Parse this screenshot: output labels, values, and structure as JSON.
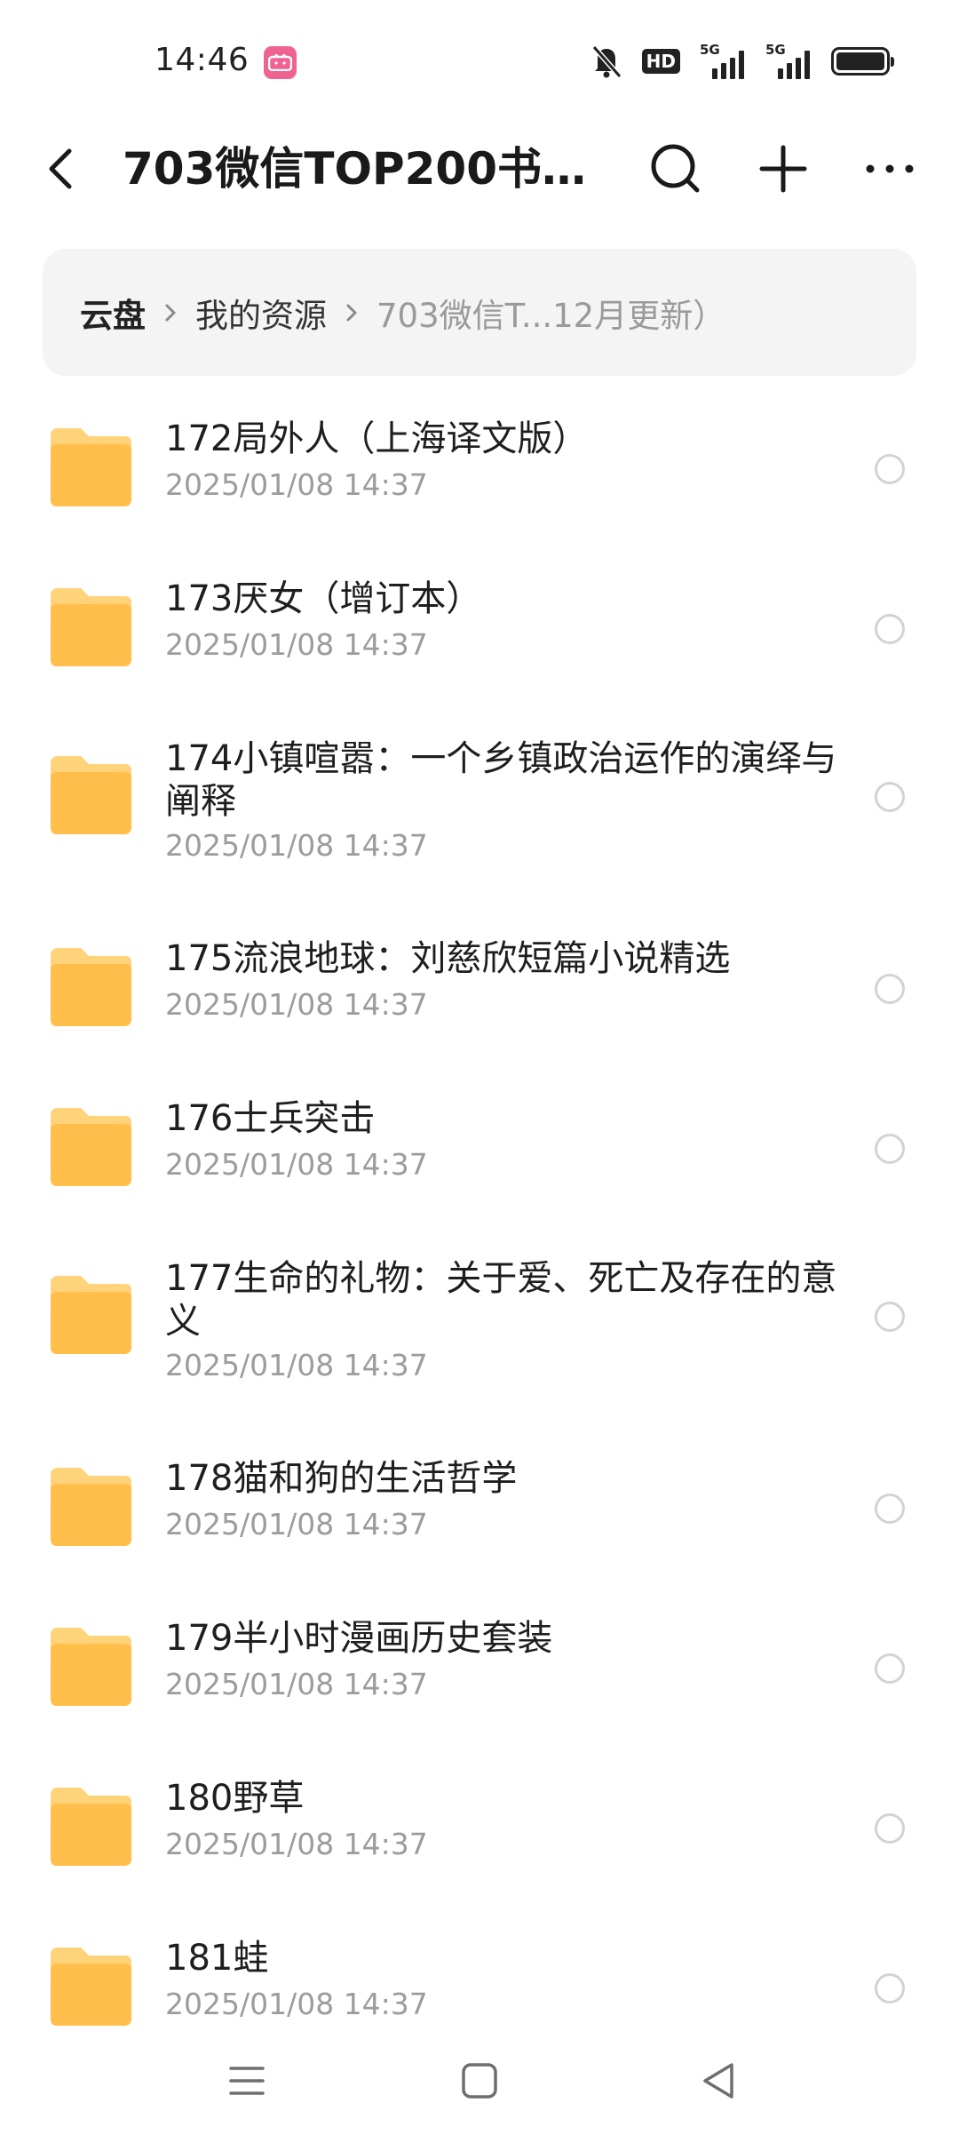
{
  "status_bar": {
    "time": "14:46",
    "app_badge_icon": "bilibili-icon",
    "icons": [
      "mute-icon",
      "hd-voice-icon",
      "signal-5g-icon",
      "signal-5g-icon",
      "battery-icon"
    ],
    "hd_label": "HD",
    "network_label": "5G",
    "network_label_2": "5G"
  },
  "header": {
    "title": "703微信TOP200书…",
    "back_icon": "back-arrow-icon",
    "actions": [
      "search-icon",
      "add-icon",
      "more-icon"
    ]
  },
  "breadcrumb": {
    "items": [
      "云盘",
      "我的资源",
      "703微信T...12月更新）"
    ]
  },
  "files": [
    {
      "name": "172局外人（上海译文版）",
      "date": "2025/01/08 14:37"
    },
    {
      "name": "173厌女（增订本）",
      "date": "2025/01/08 14:37"
    },
    {
      "name": "174小镇喧嚣：一个乡镇政治运作的演绎与阐释",
      "date": "2025/01/08 14:37"
    },
    {
      "name": "175流浪地球：刘慈欣短篇小说精选",
      "date": "2025/01/08 14:37"
    },
    {
      "name": "176士兵突击",
      "date": "2025/01/08 14:37"
    },
    {
      "name": "177生命的礼物：关于爱、死亡及存在的意义",
      "date": "2025/01/08 14:37"
    },
    {
      "name": "178猫和狗的生活哲学",
      "date": "2025/01/08 14:37"
    },
    {
      "name": "179半小时漫画历史套装",
      "date": "2025/01/08 14:37"
    },
    {
      "name": "180野草",
      "date": "2025/01/08 14:37"
    },
    {
      "name": "181蛙",
      "date": "2025/01/08 14:37"
    }
  ],
  "colors": {
    "folder_top": "#ffd37a",
    "folder_body": "#ffbf4a",
    "breadcrumb_bg": "#f4f4f4",
    "secondary_text": "#9c9c9c"
  }
}
